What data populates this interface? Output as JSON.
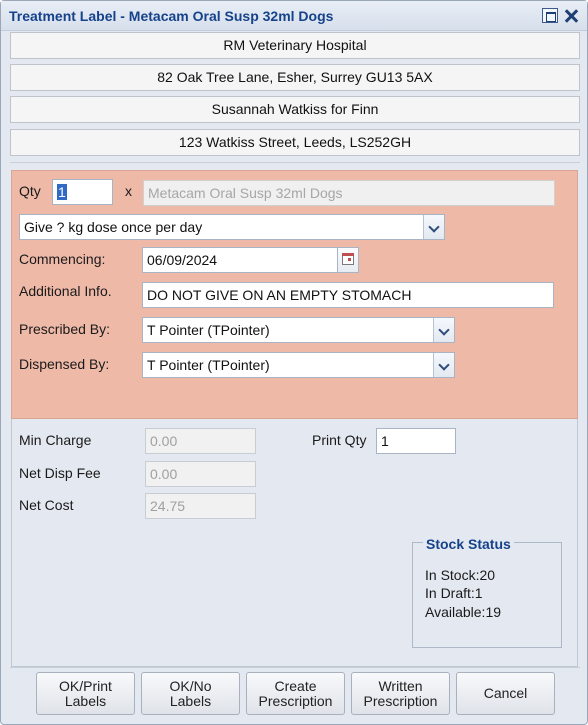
{
  "window": {
    "title": "Treatment Label - Metacam Oral Susp 32ml Dogs"
  },
  "address": [
    "RM Veterinary Hospital",
    "82 Oak Tree Lane, Esher, Surrey GU13 5AX",
    "Susannah Watkiss for Finn",
    "123 Watkiss Street, Leeds, LS252GH"
  ],
  "label": {
    "qty_label": "Qty",
    "qty_value": "1",
    "times": "x",
    "product": "Metacam Oral Susp 32ml Dogs",
    "dosage": "Give ? kg dose once per day",
    "commencing_label": "Commencing:",
    "commencing_value": "06/09/2024",
    "additional_label": "Additional Info.",
    "additional_value": "DO NOT GIVE ON AN EMPTY STOMACH",
    "prescribed_label": "Prescribed By:",
    "prescribed_value": "T Pointer (TPointer)",
    "dispensed_label": "Dispensed By:",
    "dispensed_value": "T Pointer (TPointer)"
  },
  "charges": {
    "min_charge_label": "Min Charge",
    "min_charge_value": "0.00",
    "net_disp_fee_label": "Net Disp Fee",
    "net_disp_fee_value": "0.00",
    "net_cost_label": "Net Cost",
    "net_cost_value": "24.75",
    "print_qty_label": "Print Qty",
    "print_qty_value": "1"
  },
  "stock": {
    "title": "Stock Status",
    "in_stock": "In Stock:20",
    "in_draft": "In Draft:1",
    "available": "Available:19"
  },
  "buttons": [
    {
      "line1": "OK/Print",
      "line2": "Labels"
    },
    {
      "line1": "OK/No",
      "line2": "Labels"
    },
    {
      "line1": "Create",
      "line2": "Prescription"
    },
    {
      "line1": "Written",
      "line2": "Prescription"
    },
    {
      "line1": "Cancel",
      "line2": ""
    }
  ],
  "colors": {
    "title": "#15428b",
    "label_panel": "#efb9a8",
    "window_bg": "#e4e9f1",
    "selection": "#316ac5"
  }
}
